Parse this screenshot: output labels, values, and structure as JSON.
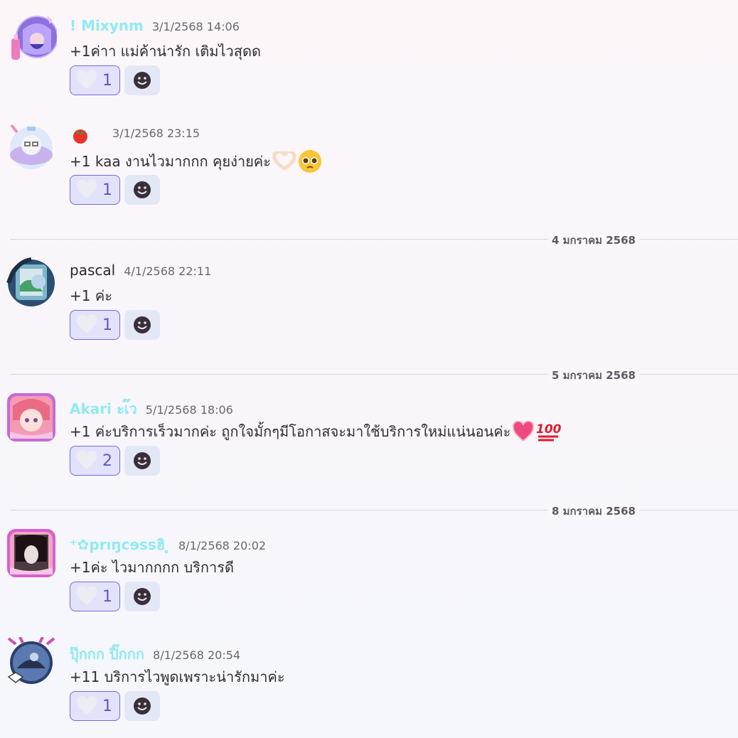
{
  "messages": [
    {
      "username": "! Mixynm",
      "timestamp": "3/1/2568 14:06",
      "text": "+1ค่าา แม่ค้าน่ารัก เติมไวสุดด",
      "reaction_count": "1"
    },
    {
      "username": "",
      "timestamp": "3/1/2568 23:15",
      "text": "+1 kaa งานไวมากกก คุยง่ายค่ะ",
      "reaction_count": "1"
    },
    {
      "username": "pascal",
      "timestamp": "4/1/2568 22:11",
      "text": "+1 ค่ะ",
      "reaction_count": "1"
    },
    {
      "username": "Akari ะเ๊ว",
      "timestamp": "5/1/2568 18:06",
      "text": "+1 ค่ะบริการเร็วมากค่ะ ถูกใจมั้กๆมีโอกาสจะมาใช้บริการใหม่แน่นอนค่ะ",
      "reaction_count": "2"
    },
    {
      "username": "⁺✿prıŋcɘssฮิ ̥",
      "timestamp": "8/1/2568 20:02",
      "text": "+1ค่ะ ไวมากกกก บริการดี",
      "reaction_count": "1"
    },
    {
      "username": "ปุ๊กกก ปิ๊กกก",
      "timestamp": "8/1/2568 20:54",
      "text": "+11 บริการไวพูดเพราะน่ารักมาค่ะ",
      "reaction_count": "1"
    }
  ],
  "dividers": [
    "4 มกราคม 2568",
    "5 มกราคม 2568",
    "8 มกราคม 2568"
  ],
  "icons": {
    "reaction": "heart-icon",
    "add_reaction": "smiley-icon",
    "emoji_tomato": "tomato-icon",
    "emoji_heart_hands": "heart-hands-icon",
    "emoji_pleading": "pleading-face-icon",
    "emoji_heart": "heart-icon",
    "emoji_hundred": "hundred-points-icon"
  },
  "colors": {
    "username_accent": "#8feaf2",
    "reaction_border": "#6e6ce0",
    "reaction_bg": "#e3e2fb"
  }
}
